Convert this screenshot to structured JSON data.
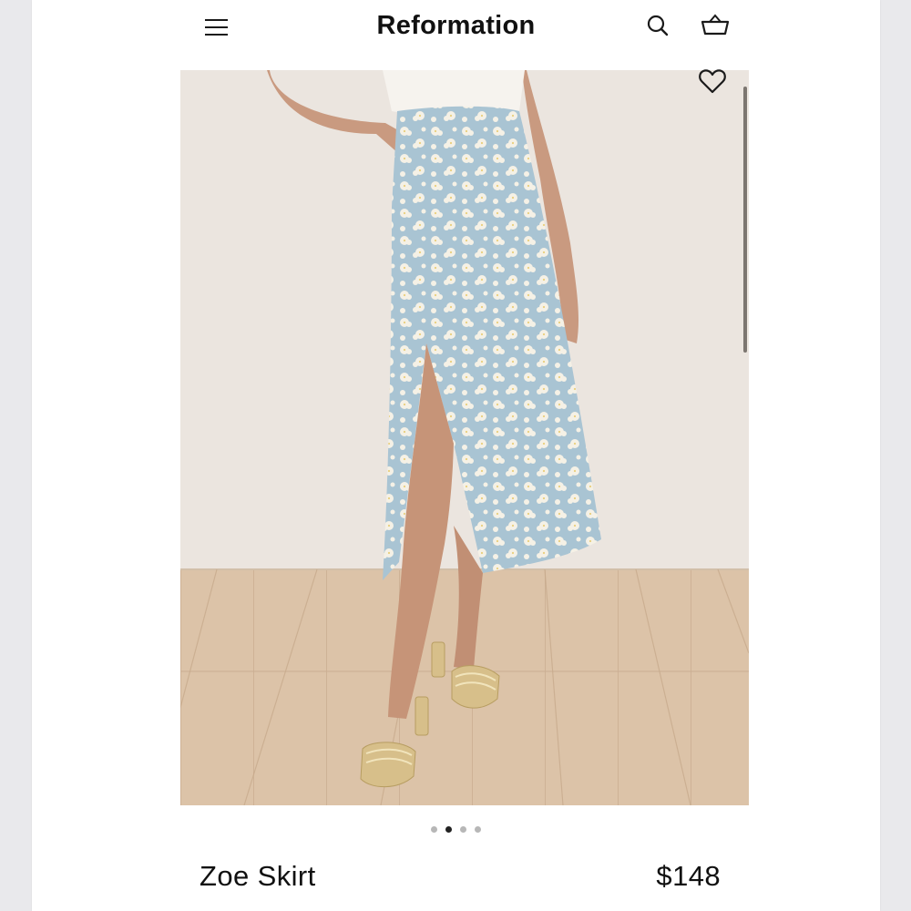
{
  "header": {
    "brand": "Reformation",
    "menu_icon": "hamburger-menu-icon",
    "search_icon": "search-icon",
    "cart_icon": "shopping-basket-icon"
  },
  "gallery": {
    "image_subject": "Model wearing light blue floral midi skirt with front slit, white top and gold strappy block-heel sandals",
    "wishlist_icon": "heart-outline-icon",
    "dot_count": 4,
    "active_dot": 2
  },
  "product": {
    "name": "Zoe Skirt",
    "price": "$148"
  },
  "colors": {
    "skirt_blue": "#a9c4d3",
    "wall": "#ebe5df",
    "floor": "#d9c0a4",
    "text": "#111111"
  }
}
